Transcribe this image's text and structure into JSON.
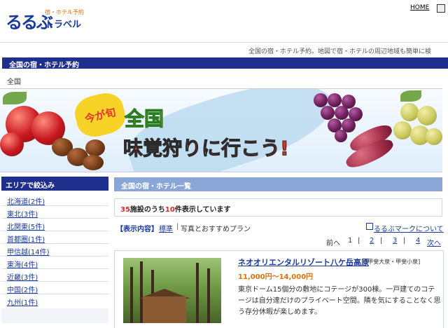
{
  "header": {
    "logo_main": "るるぶ",
    "logo_sub": "宿・ホテル予約",
    "logo_travel": "トラベル",
    "home_label": "HOME",
    "tagline": "全国の宿・ホテル予約。地図で宿・ホテルの周辺地域も簡単に検"
  },
  "titlebar": {
    "title": "全国の宿・ホテル予約"
  },
  "breadcrumb": "全国",
  "banner": {
    "badge": "今が旬",
    "headline_1": "全国",
    "headline_2": "味覚狩りに行こう!"
  },
  "sidebar": {
    "title": "エリアで絞込み",
    "items": [
      {
        "label": "北海道(2件)"
      },
      {
        "label": "東北(3件)"
      },
      {
        "label": "北関東(5件)"
      },
      {
        "label": "首都圏(1件)"
      },
      {
        "label": "甲信越(14件)"
      },
      {
        "label": "東海(4件)"
      },
      {
        "label": "近畿(3件)"
      },
      {
        "label": "中国(2件)"
      },
      {
        "label": "九州(1件)"
      }
    ]
  },
  "list": {
    "title": "全国の宿・ホテル一覧",
    "count_total": "35",
    "count_text1": "施設のうち",
    "count_shown": "10",
    "count_text2": "件表示しています",
    "display_label": "【表示内容】",
    "display_standard": "標準",
    "display_sep": "|",
    "display_photo": "写真とおすすめプラン",
    "mark_link": "るるぶマークについて",
    "pager": {
      "prev": "前へ",
      "pages": [
        "1",
        "2",
        "3",
        "4"
      ],
      "next": "次へ"
    }
  },
  "hotel": {
    "name": "ネオオリエンタルリゾート八ケ岳高原",
    "area": "[甲斐大泉・甲斐小泉]",
    "price": "11,000円～14,000円",
    "description": "東京ドーム15個分の敷地にコテージが300棟。一戸建てのコテージは自分達だけのプライベート空間。隣を気にすることなく思う存分休暇が楽しめます。"
  }
}
